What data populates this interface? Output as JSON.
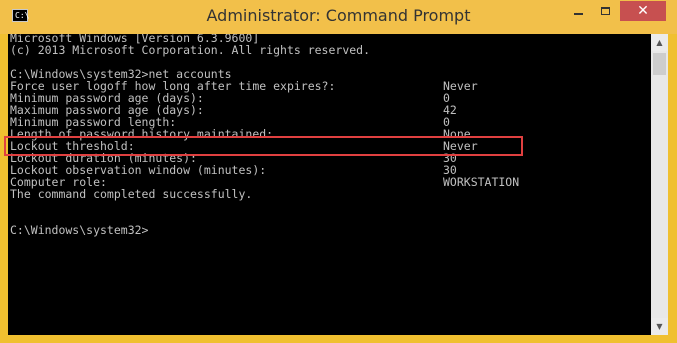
{
  "window": {
    "title": "Administrator: Command Prompt",
    "icon_label": "C:\\",
    "icon": "command-prompt-icon",
    "controls": {
      "minimize": "minimize-icon",
      "maximize": "maximize-icon",
      "close": "✕"
    },
    "accent_color": "#f2c04a",
    "close_color": "#c75050"
  },
  "console": {
    "header": [
      "Microsoft Windows [Version 6.3.9600]",
      "(c) 2013 Microsoft Corporation. All rights reserved."
    ],
    "prompt1": "C:\\Windows\\system32>net accounts",
    "settings": [
      {
        "label": "Force user logoff how long after time expires?:",
        "value": "Never"
      },
      {
        "label": "Minimum password age (days):",
        "value": "0"
      },
      {
        "label": "Maximum password age (days):",
        "value": "42"
      },
      {
        "label": "Minimum password length:",
        "value": "0"
      },
      {
        "label": "Length of password history maintained:",
        "value": "None"
      },
      {
        "label": "Lockout threshold:",
        "value": "Never"
      },
      {
        "label": "Lockout duration (minutes):",
        "value": "30"
      },
      {
        "label": "Lockout observation window (minutes):",
        "value": "30"
      },
      {
        "label": "Computer role:",
        "value": "WORKSTATION"
      }
    ],
    "completion": "The command completed successfully.",
    "prompt2": "C:\\Windows\\system32>",
    "highlight_color": "#e04040"
  },
  "scrollbar": {
    "up": "▲",
    "down": "▼"
  }
}
